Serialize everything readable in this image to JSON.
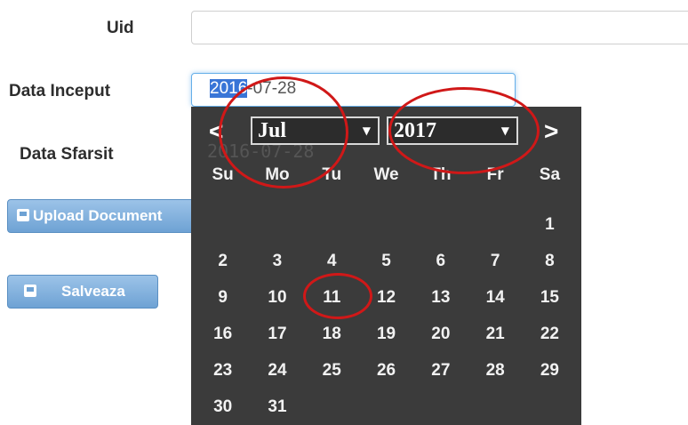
{
  "form": {
    "uid_label": "Uid",
    "uid_value": "",
    "start_label": "Data Inceput",
    "start_selected": "2016",
    "start_rest": "-07-28",
    "end_label": "Data Sfarsit",
    "end_value": "2016-07-28",
    "upload_label": "Upload Document",
    "save_label": "Salveaza"
  },
  "datepicker": {
    "prev": "<",
    "next": ">",
    "month": "Jul",
    "year": "2017",
    "weekdays": [
      "Su",
      "Mo",
      "Tu",
      "We",
      "Th",
      "Fr",
      "Sa"
    ],
    "first_weekday_index": 6,
    "days": [
      "1",
      "2",
      "3",
      "4",
      "5",
      "6",
      "7",
      "8",
      "9",
      "10",
      "11",
      "12",
      "13",
      "14",
      "15",
      "16",
      "17",
      "18",
      "19",
      "20",
      "21",
      "22",
      "23",
      "24",
      "25",
      "26",
      "27",
      "28",
      "29",
      "30",
      "31"
    ],
    "highlighted_day": "11",
    "colors": {
      "background": "#3b3b3b",
      "annotation": "#d01818",
      "text_selection": "#3875d7"
    }
  }
}
